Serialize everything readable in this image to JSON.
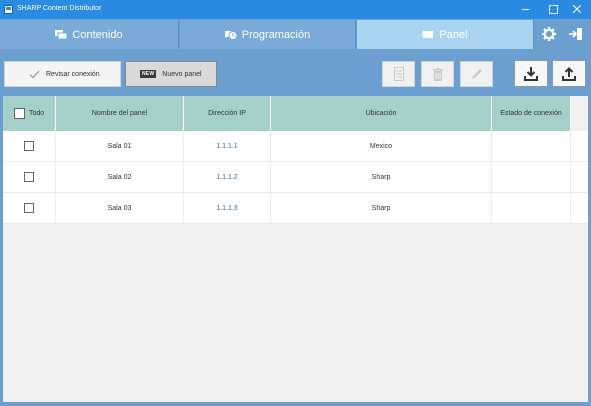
{
  "window": {
    "title": "SHARP Content Distributor"
  },
  "tabs": [
    {
      "label": "Contenido",
      "icon": "content-icon",
      "active": false
    },
    {
      "label": "Programación",
      "icon": "schedule-icon",
      "active": false
    },
    {
      "label": "Panel",
      "icon": "panel-icon",
      "active": true
    }
  ],
  "toolbar": {
    "revisar_label": "Revisar conexión",
    "nuevo_badge": "NEW",
    "nuevo_label": "Nuevo panel"
  },
  "table": {
    "headers": {
      "todo": "Todo",
      "nombre": "Nombre del panel",
      "ip": "Dirección IP",
      "ubicacion": "Ubicación",
      "estado": "Estado de conexión"
    },
    "rows": [
      {
        "nombre": "Sala 01",
        "ip": "1.1.1.1",
        "ubicacion": "Mexico",
        "estado": ""
      },
      {
        "nombre": "Sala 02",
        "ip": "1.1.1.2",
        "ubicacion": "Sharp",
        "estado": ""
      },
      {
        "nombre": "Sala 03",
        "ip": "1.1.1.3",
        "ubicacion": "Sharp",
        "estado": ""
      }
    ]
  },
  "colors": {
    "background": "#6a9fd0",
    "titlebar": "#2a8be3",
    "active_tab": "#a8d4f2",
    "table_header": "#a5d0ca"
  }
}
